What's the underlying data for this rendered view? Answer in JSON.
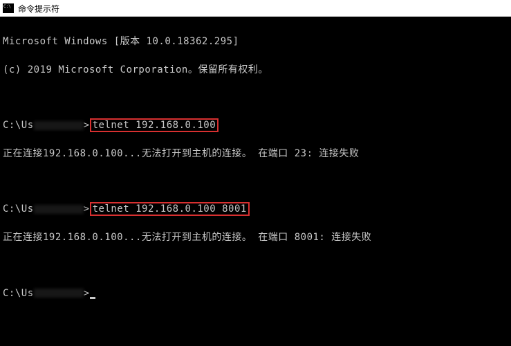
{
  "titlebar": {
    "title": "命令提示符"
  },
  "terminal": {
    "banner_line1": "Microsoft Windows [版本 10.0.18362.295]",
    "banner_line2": "(c) 2019 Microsoft Corporation。保留所有权利。",
    "prompt_prefix": "C:\\Us",
    "prompt_suffix": ">",
    "command1": "telnet 192.168.0.100",
    "result1": "正在连接192.168.0.100...无法打开到主机的连接。 在端口 23: 连接失败",
    "command2": "telnet 192.168.0.100 8001",
    "result2": "正在连接192.168.0.100...无法打开到主机的连接。 在端口 8001: 连接失败"
  }
}
